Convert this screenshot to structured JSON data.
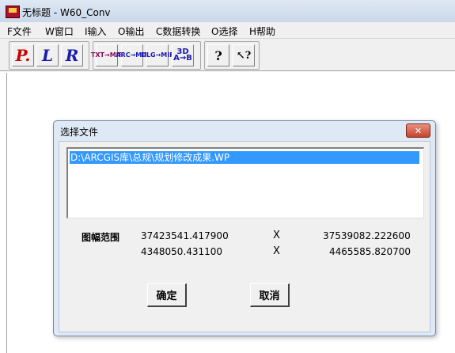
{
  "window": {
    "title": "无标题 - W60_Conv"
  },
  "menu": [
    "F文件",
    "W窗口",
    "I输入",
    "O输出",
    "C数据转换",
    "O选择",
    "H帮助"
  ],
  "toolbar": {
    "groups": [
      [
        "P.",
        "L",
        "R"
      ],
      [
        "TXT→MIF",
        "ARC→MIF",
        "DLG→MIF",
        "3D A→B"
      ],
      [
        "?",
        "↖?"
      ]
    ]
  },
  "dialog": {
    "title": "选择文件",
    "close_label": "✕",
    "files": [
      "D:\\ARCGIS库\\总规\\规划修改成果.WP"
    ],
    "range_label": "图幅范围",
    "range": {
      "xmin": "37423541.417900",
      "ymin": "4348050.431100",
      "xmax": "37539082.222600",
      "ymax": "4465585.820700",
      "separator": "X"
    },
    "ok_label": "确定",
    "cancel_label": "取消"
  }
}
